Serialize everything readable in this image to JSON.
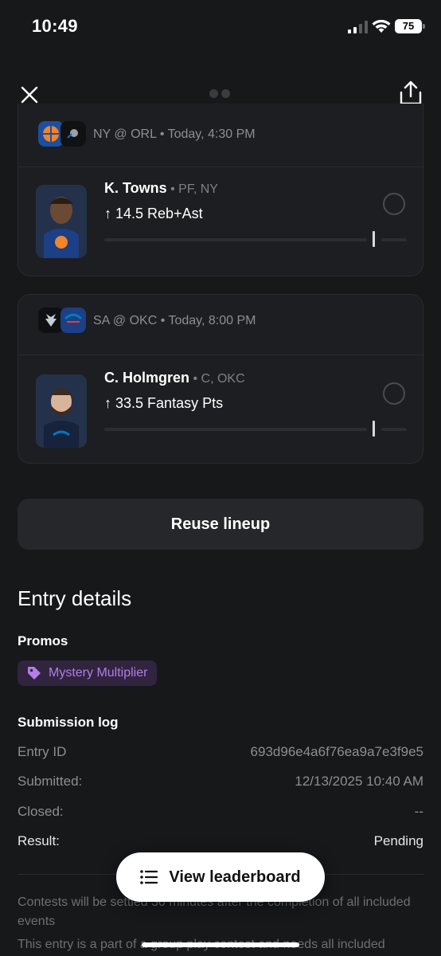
{
  "status_bar": {
    "time": "10:49",
    "battery": "75"
  },
  "nav": {
    "close_icon": "close-icon",
    "share_icon": "share-icon"
  },
  "picks": [
    {
      "game": "NY @ ORL",
      "game_time": "Today, 4:30 PM",
      "team_logos": [
        "knicks-logo",
        "magic-logo"
      ],
      "player": "K. Towns",
      "meta": "PF, NY",
      "direction": "↑",
      "line": "14.5 Reb+Ast"
    },
    {
      "game": "SA @ OKC",
      "game_time": "Today, 8:00 PM",
      "team_logos": [
        "spurs-logo",
        "thunder-logo"
      ],
      "player": "C. Holmgren",
      "meta": "C, OKC",
      "direction": "↑",
      "line": "33.5 Fantasy Pts"
    }
  ],
  "reuse_label": "Reuse lineup",
  "entry_details": {
    "title": "Entry details",
    "promos_label": "Promos",
    "promo": "Mystery Multiplier",
    "submission_log_label": "Submission log",
    "rows": [
      {
        "key": "Entry ID",
        "value": "693d96e4a6f76ea9a7e3f9e5"
      },
      {
        "key": "Submitted:",
        "value": "12/13/2025 10:40 AM"
      },
      {
        "key": "Closed:",
        "value": "--"
      },
      {
        "key": "Result:",
        "value": "Pending"
      }
    ]
  },
  "footnotes": [
    "Contests will be settled 30 minutes after the completion of all included events",
    "This entry is a part of a group play contest and needs all included"
  ],
  "leaderboard_label": "View leaderboard",
  "colors": {
    "background": "#17181a",
    "card": "#1d1e21",
    "promo_text": "#b27ee8",
    "promo_bg": "#31243f"
  }
}
